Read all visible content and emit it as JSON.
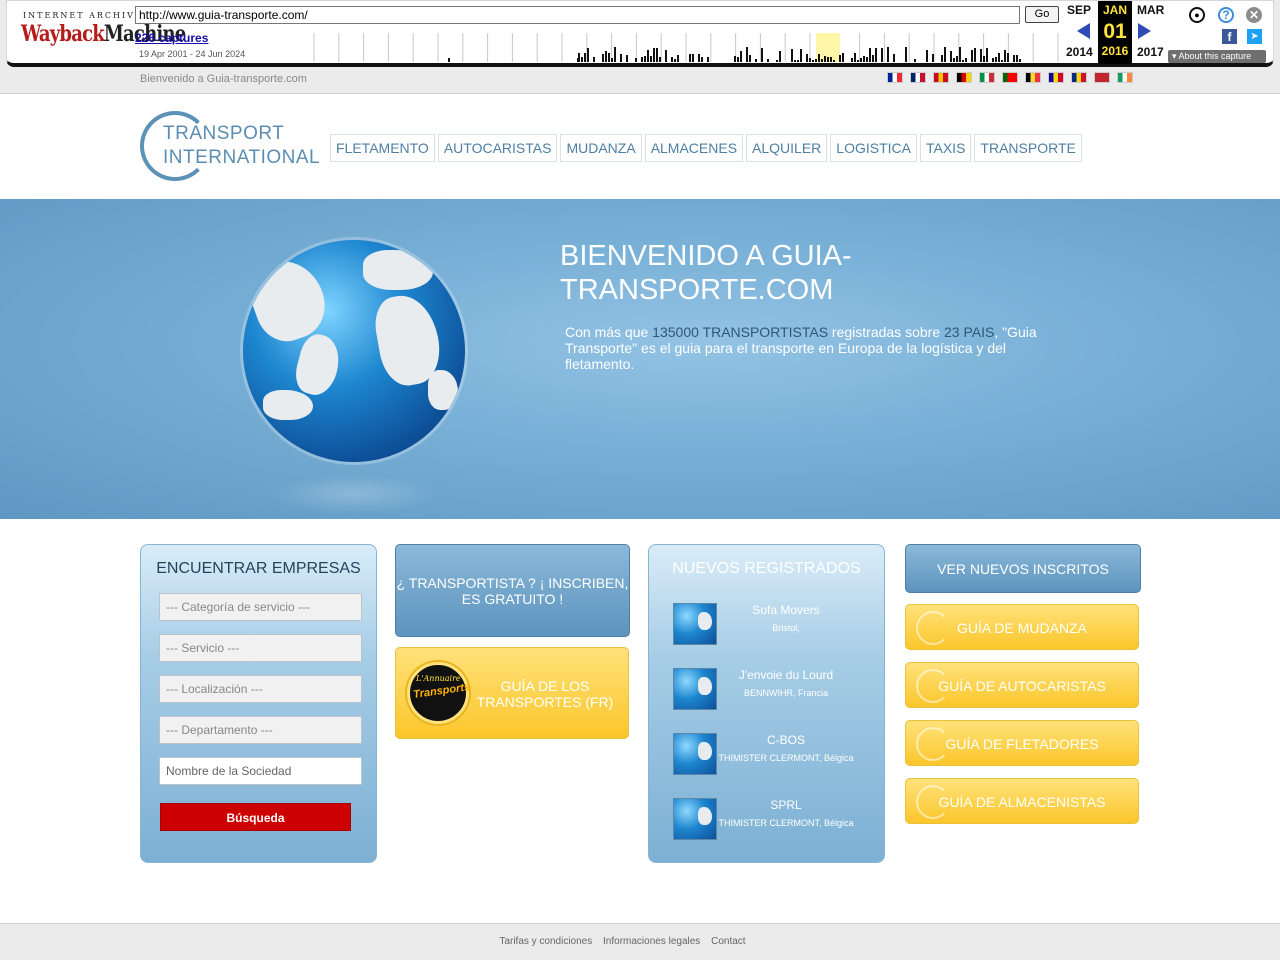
{
  "wayback": {
    "logo_top": "INTERNET ARCHIVE",
    "logo_main_a": "Wayback",
    "logo_main_b": "Machine",
    "url": "http://www.guia-transporte.com/",
    "go_label": "Go",
    "captures": "226 captures",
    "date_range": "19 Apr 2001 - 24 Jun 2024",
    "prev": {
      "month": "SEP",
      "year": "2014"
    },
    "current": {
      "month": "JAN",
      "day": "01",
      "year": "2016"
    },
    "next": {
      "month": "MAR",
      "year": "2017"
    },
    "about_label": "About this capture",
    "icons": [
      "user-icon",
      "help-icon",
      "close-icon",
      "facebook-icon",
      "twitter-icon"
    ],
    "accent_color": "#ffe43a"
  },
  "topbar": {
    "welcome": "Bienvenido a Guia-transporte.com",
    "flags": [
      {
        "lang": "fr",
        "colors": [
          "#002395",
          "#ffffff",
          "#ed2939"
        ]
      },
      {
        "lang": "en",
        "colors": [
          "#012169",
          "#ffffff",
          "#c8102e"
        ]
      },
      {
        "lang": "es",
        "colors": [
          "#c60b1e",
          "#ffc400",
          "#c60b1e"
        ]
      },
      {
        "lang": "de",
        "colors": [
          "#000000",
          "#dd0000",
          "#ffce00"
        ]
      },
      {
        "lang": "it",
        "colors": [
          "#009246",
          "#ffffff",
          "#ce2b37"
        ]
      },
      {
        "lang": "pt",
        "colors": [
          "#006600",
          "#ff0000",
          "#ff0000"
        ]
      },
      {
        "lang": "be",
        "colors": [
          "#000000",
          "#fdda24",
          "#ef3340"
        ]
      },
      {
        "lang": "ad",
        "colors": [
          "#10069f",
          "#fedd00",
          "#d50032"
        ]
      },
      {
        "lang": "ro",
        "colors": [
          "#002b7f",
          "#fcd116",
          "#ce1126"
        ]
      },
      {
        "lang": "ma",
        "colors": [
          "#c1272d",
          "#c1272d",
          "#c1272d"
        ]
      },
      {
        "lang": "ie",
        "colors": [
          "#169b62",
          "#ffffff",
          "#ff883e"
        ]
      }
    ]
  },
  "header": {
    "logo_line1": "TRANSPORT",
    "logo_line2": "INTERNATIONAL",
    "nav": [
      "FLETAMENTO",
      "AUTOCARISTAS",
      "MUDANZA",
      "ALMACENES",
      "ALQUILER",
      "LOGISTICA",
      "TAXIS",
      "TRANSPORTE"
    ]
  },
  "hero": {
    "title": "BIENVENIDO A GUIA-TRANSPORTE.COM",
    "text_pre": "Con más que ",
    "text_hl1": "135000 TRANSPORTISTAS",
    "text_mid": " registradas sobre ",
    "text_hl2": "23 PAIS",
    "text_post": ", \"Guia Transporte\" es el guia para el transporte en Europa de la logística y del fletamento."
  },
  "search": {
    "title": "ENCUENTRAR EMPRESAS",
    "category": "--- Categoría de servicio ---",
    "service": "--- Servicio ---",
    "location": "--- Localización ---",
    "department": "--- Departamento ---",
    "company_placeholder": "Nombre de la Sociedad",
    "button": "Búsqueda"
  },
  "signup": {
    "label": "¿ TRANSPORTISTA ? ¡ INSCRIBEN, ES GRATUITO !"
  },
  "guide_fr": {
    "label": "GUÍA DE LOS TRANSPORTES (FR)",
    "badge_a": "L'Annuaire",
    "badge_b": "Transports"
  },
  "new_registered": {
    "title": "NUEVOS REGISTRADOS",
    "items": [
      {
        "name": "Sofa Movers",
        "location": "Bristol,"
      },
      {
        "name": "J'envoie du Lourd",
        "location": "BENNWIHR, Francia"
      },
      {
        "name": "C-BOS",
        "location": "THIMISTER CLERMONT, Bélgica"
      },
      {
        "name": "SPRL",
        "location": "THIMISTER CLERMONT, Bélgica"
      }
    ]
  },
  "right_buttons": {
    "new_inscribed": "VER NUEVOS INSCRITOS",
    "guides": [
      "GUÍA DE MUDANZA",
      "GUÍA DE AUTOCARISTAS",
      "GUÍA DE FLETADORES",
      "GUÍA DE ALMACENISTAS"
    ]
  },
  "footer": {
    "links": [
      "Tarifas y condiciones",
      "Informaciones legales",
      "Contact"
    ]
  },
  "colors": {
    "brand_blue": "#5b8db3",
    "search_button": "#cc0000",
    "guide_yellow": "#fbc62b"
  }
}
